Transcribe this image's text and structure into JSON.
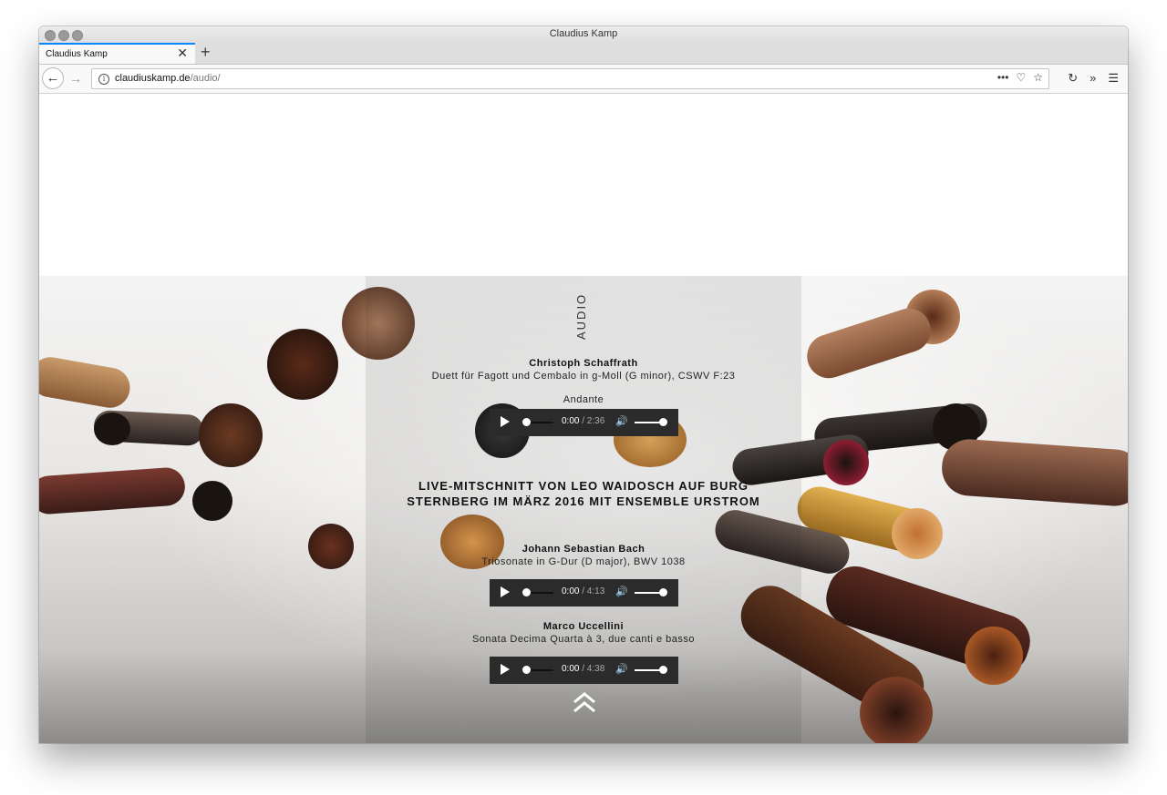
{
  "window": {
    "title": "Claudius Kamp"
  },
  "tab": {
    "title": "Claudius Kamp",
    "close": "✕",
    "new_tab": "+"
  },
  "nav": {
    "back": "←",
    "forward": "→",
    "url_host": "claudiuskamp.de",
    "url_path": "/audio/",
    "actions": [
      "•••",
      "♡",
      "☆"
    ],
    "right": [
      "↻",
      "»",
      "☰"
    ]
  },
  "page": {
    "heading": "AUDIO",
    "tracks": [
      {
        "composer": "Christoph Schaffrath",
        "work": "Duett für Fagott und Cembalo in g-Moll (G minor), CSWV F:23",
        "movement": "Andante",
        "player": {
          "current": "0:00",
          "duration": "/ 2:36"
        }
      }
    ],
    "live_heading_line1": "LIVE-MITSCHNITT VON LEO WAIDOSCH AUF BURG",
    "live_heading_line2": "STERNBERG IM MÄRZ 2016 MIT ENSEMBLE URSTROM",
    "live_tracks": [
      {
        "composer": "Johann Sebastian Bach",
        "work": "Triosonate in G-Dur (D major), BWV 1038",
        "player": {
          "current": "0:00",
          "duration": "/ 4:13"
        }
      },
      {
        "composer": "Marco Uccellini",
        "work": "Sonata Decima Quarta à 3, due canti e basso",
        "player": {
          "current": "0:00",
          "duration": "/ 4:38"
        }
      }
    ],
    "volume_icon": "🔊"
  },
  "icons": {
    "info": "i",
    "scroll_top": "double-chevron-up-icon"
  }
}
